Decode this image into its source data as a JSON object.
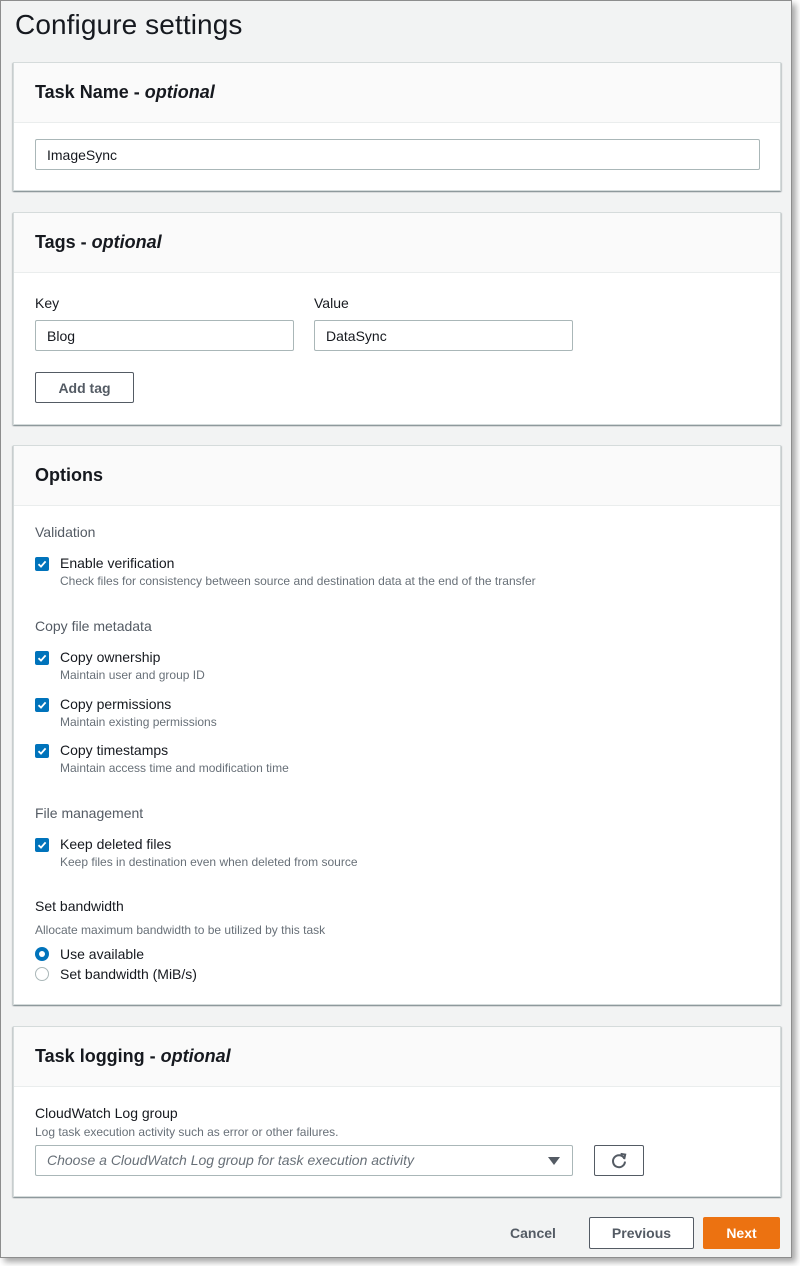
{
  "page": {
    "title": "Configure settings"
  },
  "task_name": {
    "heading": "Task Name - ",
    "heading_optional": "optional",
    "value": "ImageSync"
  },
  "tags": {
    "heading": "Tags - ",
    "heading_optional": "optional",
    "key_label": "Key",
    "value_label": "Value",
    "key_value": "Blog",
    "value_value": "DataSync",
    "add_button": "Add tag"
  },
  "options": {
    "heading": "Options",
    "validation": {
      "label": "Validation",
      "items": [
        {
          "title": "Enable verification",
          "desc": "Check files for consistency between source and destination data at the end of the transfer",
          "checked": true
        }
      ]
    },
    "metadata": {
      "label": "Copy file metadata",
      "items": [
        {
          "title": "Copy ownership",
          "desc": "Maintain user and group ID",
          "checked": true
        },
        {
          "title": "Copy permissions",
          "desc": "Maintain existing permissions",
          "checked": true
        },
        {
          "title": "Copy timestamps",
          "desc": "Maintain access time and modification time",
          "checked": true
        }
      ]
    },
    "file_management": {
      "label": "File management",
      "items": [
        {
          "title": "Keep deleted files",
          "desc": "Keep files in destination even when deleted from source",
          "checked": true
        }
      ]
    },
    "bandwidth": {
      "label": "Set bandwidth",
      "desc": "Allocate maximum bandwidth to be utilized by this task",
      "options": [
        {
          "label": "Use available",
          "selected": true
        },
        {
          "label": "Set bandwidth (MiB/s)",
          "selected": false
        }
      ]
    }
  },
  "logging": {
    "heading": "Task logging - ",
    "heading_optional": "optional",
    "group_label": "CloudWatch Log group",
    "group_desc": "Log task execution activity such as error or other failures.",
    "select_placeholder": "Choose a CloudWatch Log group for task execution activity"
  },
  "footer": {
    "cancel": "Cancel",
    "previous": "Previous",
    "next": "Next"
  },
  "colors": {
    "primary": "#ec7211",
    "checkbox": "#0073bb"
  },
  "icons": {
    "check": "check-icon",
    "caret": "caret-down-icon",
    "refresh": "refresh-icon"
  }
}
